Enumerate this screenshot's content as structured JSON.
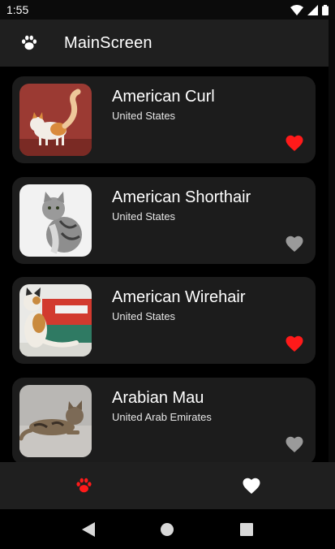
{
  "status": {
    "time": "1:55"
  },
  "appbar": {
    "title": "MainScreen",
    "icon": "paw-icon"
  },
  "cats": [
    {
      "name": "American Curl",
      "origin": "United States",
      "favorite": true
    },
    {
      "name": "American Shorthair",
      "origin": "United States",
      "favorite": false
    },
    {
      "name": "American Wirehair",
      "origin": "United States",
      "favorite": true
    },
    {
      "name": "Arabian Mau",
      "origin": "United Arab Emirates",
      "favorite": false
    }
  ],
  "colors": {
    "favorite": "#ff1a1a",
    "not_favorite": "#9a9a9a",
    "nav_active": "#ff1a1a"
  },
  "bottom_nav": [
    {
      "icon": "paw-icon",
      "selected": true
    },
    {
      "icon": "heart-icon",
      "selected": false
    }
  ]
}
